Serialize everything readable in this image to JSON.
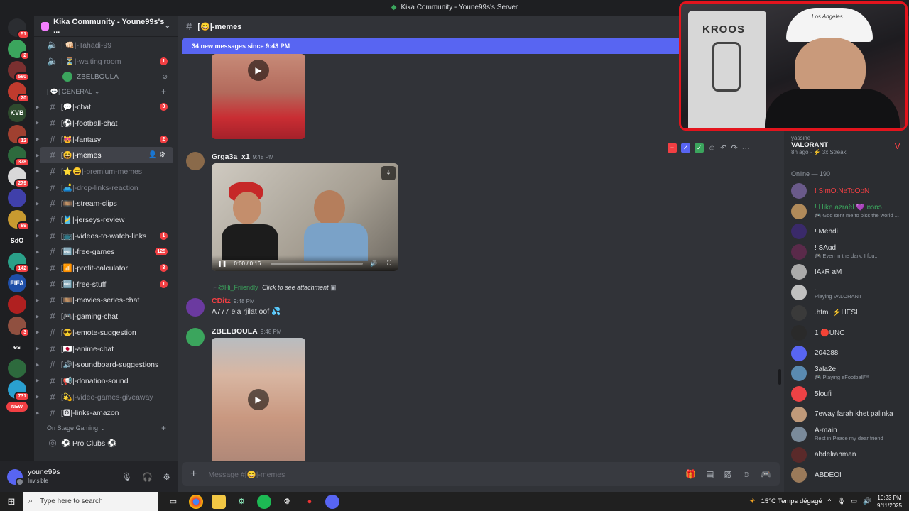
{
  "window": {
    "title": "Kika Community - Youne99s's Server"
  },
  "servers": [
    {
      "label": "",
      "badge": "51",
      "color": "#2b2d31"
    },
    {
      "label": "",
      "badge": "2",
      "color": "#3ba55d"
    },
    {
      "label": "",
      "badge": "560",
      "color": "#7a3030"
    },
    {
      "label": "",
      "badge": "20",
      "color": "#c03b2e"
    },
    {
      "label": "KVB",
      "badge": "",
      "color": "#2e4a2e"
    },
    {
      "label": "",
      "badge": "12",
      "color": "#a04030"
    },
    {
      "label": "",
      "badge": "378",
      "color": "#2d6a3d"
    },
    {
      "label": "",
      "badge": "279",
      "color": "#d8d8d8"
    },
    {
      "label": "",
      "badge": "",
      "color": "#4040aa"
    },
    {
      "label": "",
      "badge": "89",
      "color": "#c89a30"
    },
    {
      "label": "SdO",
      "badge": "",
      "color": "#1e1f22"
    },
    {
      "label": "",
      "badge": "142",
      "color": "#2aa088"
    },
    {
      "label": "FIFA",
      "badge": "",
      "color": "#1f4fa8"
    },
    {
      "label": "",
      "badge": "",
      "color": "#b02020"
    },
    {
      "label": "",
      "badge": "3",
      "color": "#905040"
    },
    {
      "label": "es",
      "badge": "",
      "color": "#1e1f22"
    },
    {
      "label": "",
      "badge": "",
      "color": "#2d6a3d"
    },
    {
      "label": "",
      "badge": "731",
      "color": "#2aa0d0"
    }
  ],
  "new_badge": "NEW",
  "guild": {
    "name": "Kika Community - Youne99s's ..."
  },
  "voice_channels": [
    {
      "label": "| 👊🏻|-Tahadi-99"
    },
    {
      "label": "| ⏳|-waiting room",
      "badge": "1"
    }
  ],
  "voice_user": {
    "name": "ZBELBOULA"
  },
  "category_general": "| 💬| GENERAL",
  "text_channels": [
    {
      "label": "[💬|-chat",
      "badge": "3",
      "muted": false,
      "active": false
    },
    {
      "label": "[⚽|-football-chat",
      "badge": "",
      "muted": false,
      "active": false
    },
    {
      "label": "[😻|-fantasy",
      "badge": "2",
      "muted": false,
      "active": false
    },
    {
      "label": "[😄|-memes",
      "badge": "",
      "muted": false,
      "active": true
    },
    {
      "label": "[⭐😄|-premium-memes",
      "badge": "",
      "muted": true,
      "active": false
    },
    {
      "label": "[🛋️|-drop-links-reaction",
      "badge": "",
      "muted": true,
      "active": false
    },
    {
      "label": "[🎞️|-stream-clips",
      "badge": "",
      "muted": false,
      "active": false
    },
    {
      "label": "[🎽|-jerseys-review",
      "badge": "",
      "muted": false,
      "active": false
    },
    {
      "label": "[📺|-videos-to-watch-links",
      "badge": "1",
      "muted": false,
      "active": false
    },
    {
      "label": "[🆓|-free-games",
      "badge": "125",
      "muted": false,
      "active": false
    },
    {
      "label": "[📶|-profit-calculator",
      "badge": "3",
      "muted": false,
      "active": false
    },
    {
      "label": "[🆓|-free-stuff",
      "badge": "1",
      "muted": false,
      "active": false
    },
    {
      "label": "[🎞️|-movies-series-chat",
      "badge": "",
      "muted": false,
      "active": false
    },
    {
      "label": "[🎮|-gaming-chat",
      "badge": "",
      "muted": false,
      "active": false
    },
    {
      "label": "[😎|-emote-suggestion",
      "badge": "",
      "muted": false,
      "active": false
    },
    {
      "label": "[🇯🇵|-anime-chat",
      "badge": "",
      "muted": false,
      "active": false
    },
    {
      "label": "[🔊|-soundboard-suggestions",
      "badge": "",
      "muted": false,
      "active": false
    },
    {
      "label": "[📢|-donation-sound",
      "badge": "",
      "muted": false,
      "active": false
    },
    {
      "label": "[💫|-video-games-giveaway",
      "badge": "",
      "muted": true,
      "active": false
    },
    {
      "label": "[🅾|-links-amazon",
      "badge": "",
      "muted": false,
      "active": false
    }
  ],
  "category_stage": "On Stage Gaming",
  "stage_channel": "⚽ Pro Clubs ⚽",
  "user": {
    "name": "youne99s",
    "status": "Invisible"
  },
  "chat": {
    "channel": "[😄|-memes",
    "new_messages": "34 new messages since 9:43 PM",
    "messages": [
      {
        "author": "Grga3a_x1",
        "time": "9:48 PM"
      },
      {
        "author": "CDitz",
        "time": "9:48 PM",
        "reply_user": "@Hi_Friiendly",
        "reply_text": "Click to see attachment",
        "text": "A777 ela rjilat oof 💦"
      },
      {
        "author": "ZBELBOULA",
        "time": "9:48 PM"
      }
    ],
    "video_time": "0:00 / 0:16",
    "video_progress": 0.0,
    "composer_placeholder": "Message #[😄|-memes"
  },
  "members": {
    "game_user": "yassine",
    "game": "VALORANT",
    "game_sub": "8h ago · ⚡ 3x Streak",
    "online_header": "Online — 190",
    "list": [
      {
        "name": "! SimO.NeToOoN",
        "activity": "",
        "color": "#f23f43"
      },
      {
        "name": "! Hike azraël 💜 ɒɔɒɔ",
        "activity": "🎮 God sent me to piss the world ...",
        "color": "#3ba55d"
      },
      {
        "name": "! Mehdi",
        "activity": "",
        "color": "#dbdee1"
      },
      {
        "name": "! SAɑd",
        "activity": "🎮 Even in the dark, I fou...",
        "color": "#dbdee1"
      },
      {
        "name": "!AkR aM",
        "activity": "",
        "color": "#dbdee1"
      },
      {
        "name": ".",
        "activity": "Playing VALORANT",
        "color": "#dbdee1"
      },
      {
        "name": ".htm. ⚡HESI",
        "activity": "",
        "color": "#dbdee1"
      },
      {
        "name": "1 🛑UNC",
        "activity": "",
        "color": "#dbdee1"
      },
      {
        "name": "204288",
        "activity": "",
        "color": "#dbdee1"
      },
      {
        "name": "3ala2e",
        "activity": "🎮 Playing eFootball™",
        "color": "#dbdee1"
      },
      {
        "name": "5loufi",
        "activity": "",
        "color": "#dbdee1"
      },
      {
        "name": "7eway farah khet palinka",
        "activity": "",
        "color": "#dbdee1"
      },
      {
        "name": "A-main",
        "activity": "Rest in Peace my dear friend",
        "color": "#dbdee1"
      },
      {
        "name": "abdelrahman",
        "activity": "",
        "color": "#dbdee1"
      },
      {
        "name": "ABDEOI",
        "activity": "",
        "color": "#dbdee1"
      }
    ]
  },
  "webcam": {
    "jersey": "KROOS",
    "cap": "Los Angeles"
  },
  "taskbar": {
    "search_placeholder": "Type here to search",
    "weather": "15°C Temps dégagé",
    "time": "10:23 PM",
    "date": "9/11/2025"
  }
}
